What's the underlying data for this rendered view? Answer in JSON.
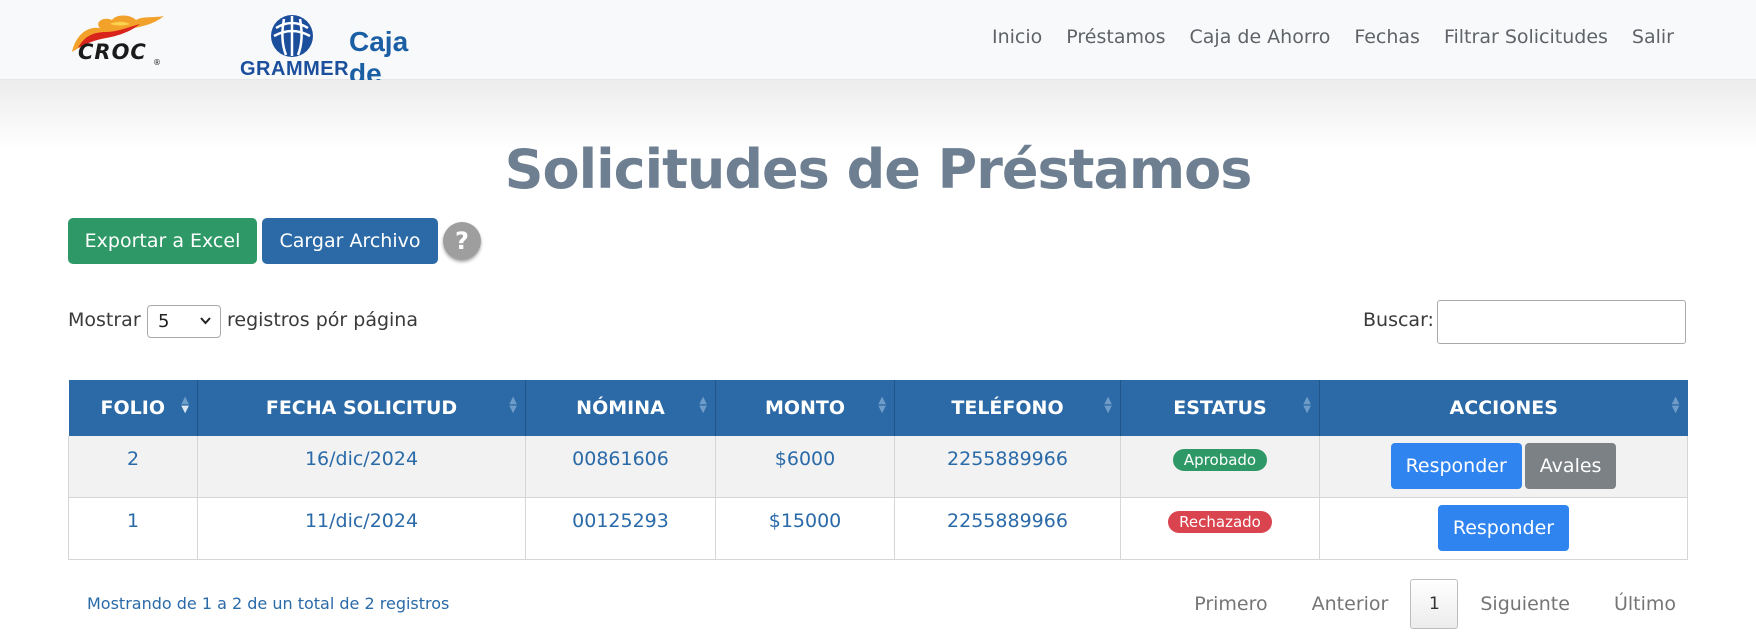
{
  "brand": {
    "croc_text": "CROC",
    "croc_reg": "®",
    "grammer_text": "GRAMMER",
    "title": "Caja de Ahorro"
  },
  "nav": {
    "items": [
      {
        "label": "Inicio"
      },
      {
        "label": "Préstamos"
      },
      {
        "label": "Caja de Ahorro"
      },
      {
        "label": "Fechas"
      },
      {
        "label": "Filtrar Solicitudes"
      },
      {
        "label": "Salir"
      }
    ]
  },
  "page": {
    "title": "Solicitudes de Préstamos"
  },
  "actions": {
    "export_label": "Exportar a Excel",
    "upload_label": "Cargar Archivo",
    "help_label": "?"
  },
  "length": {
    "label": "Mostrar",
    "value": "5",
    "suffix": "registros pór página"
  },
  "search": {
    "label": "Buscar:",
    "value": ""
  },
  "table": {
    "headers": [
      "FOLIO",
      "FECHA SOLICITUD",
      "NÓMINA",
      "MONTO",
      "TELÉFONO",
      "ESTATUS",
      "ACCIONES"
    ],
    "rows": [
      {
        "folio": "2",
        "fecha": "16/dic/2024",
        "nomina": "00861606",
        "monto": "$6000",
        "telefono": "2255889966",
        "estatus": "Aprobado",
        "acciones": [
          "Responder",
          "Avales"
        ]
      },
      {
        "folio": "1",
        "fecha": "11/dic/2024",
        "nomina": "00125293",
        "monto": "$15000",
        "telefono": "2255889966",
        "estatus": "Rechazado",
        "acciones": [
          "Responder"
        ]
      }
    ]
  },
  "footer": {
    "info": "Mostrando de 1 a 2 de un total de 2 registros",
    "first": "Primero",
    "prev": "Anterior",
    "current": "1",
    "next": "Siguiente",
    "last": "Último"
  },
  "colors": {
    "primary": "#2b6aa6",
    "success": "#2e9966",
    "danger": "#d9444f",
    "action_blue": "#3084f0",
    "action_gray": "#7c8186"
  },
  "icons": [
    "croc-flame-icon",
    "grammer-globe-icon",
    "help-icon",
    "sort-icon",
    "chevron-down-icon"
  ]
}
